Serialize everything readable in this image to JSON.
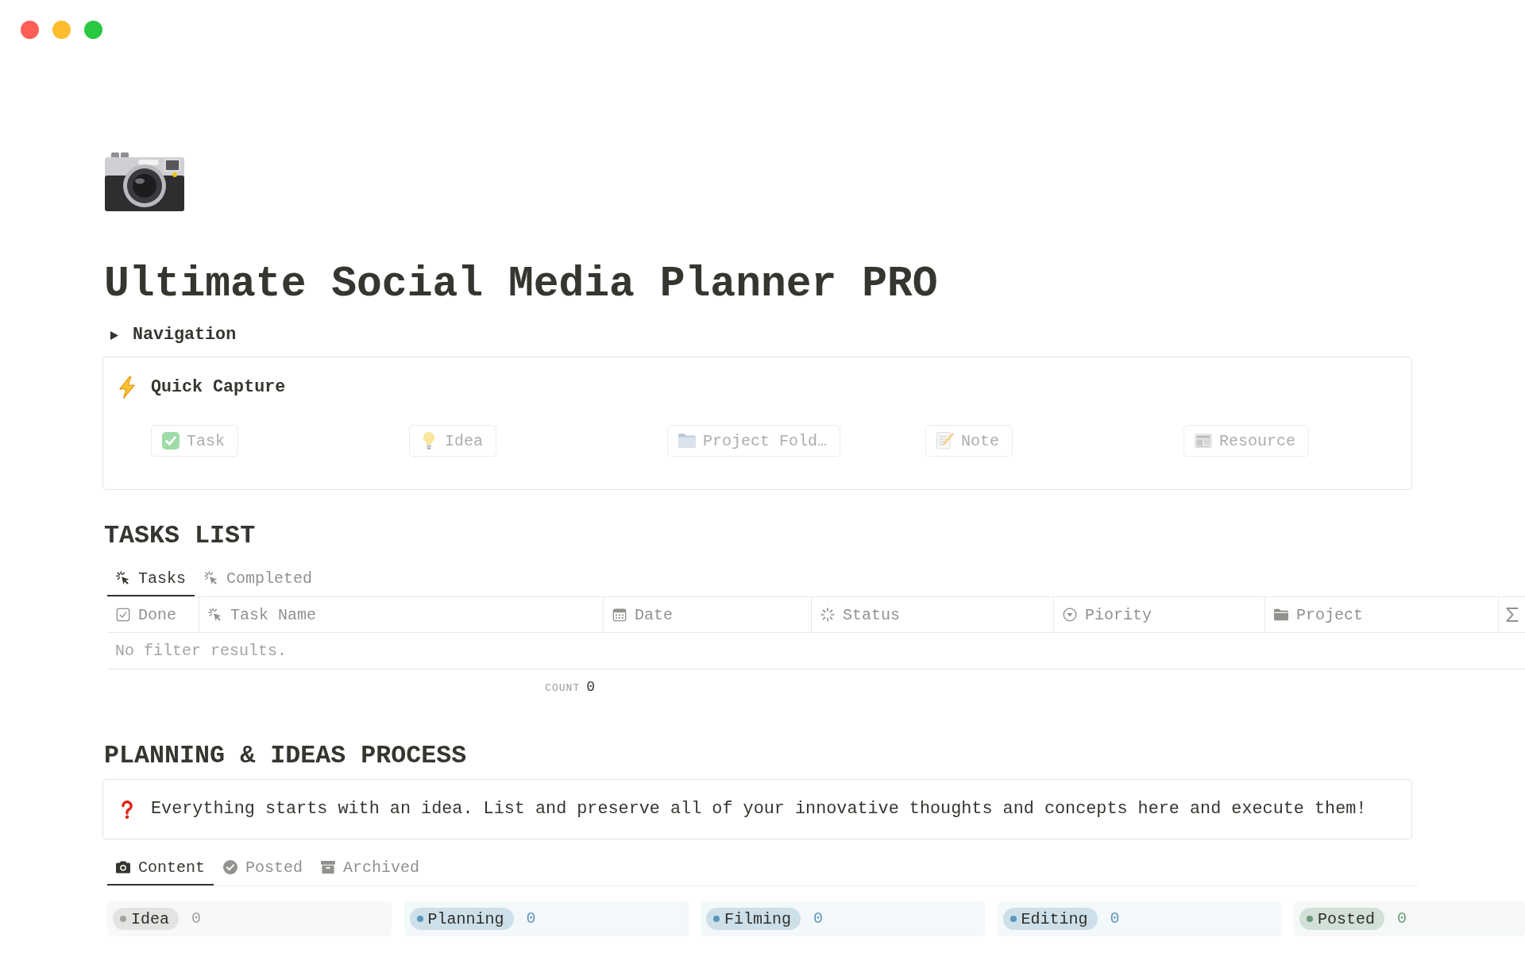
{
  "window_controls": [
    {
      "color": "#ff5f57"
    },
    {
      "color": "#febc2e"
    },
    {
      "color": "#28c840"
    }
  ],
  "page": {
    "title": "Ultimate Social Media Planner PRO"
  },
  "navigation": {
    "label": "Navigation",
    "expanded": false
  },
  "quick_capture": {
    "title": "Quick Capture",
    "buttons": [
      {
        "kind": "task",
        "label": "Task",
        "disabled": true
      },
      {
        "kind": "idea",
        "label": "Idea",
        "disabled": true
      },
      {
        "kind": "project",
        "label": "Project Fold…",
        "disabled": true
      },
      {
        "kind": "note",
        "label": "Note",
        "disabled": true
      },
      {
        "kind": "resource",
        "label": "Resource",
        "disabled": true
      }
    ]
  },
  "tasks_list": {
    "title": "TASKS LIST",
    "tabs": [
      {
        "label": "Tasks",
        "selected": true
      },
      {
        "label": "Completed",
        "selected": false
      }
    ],
    "table": {
      "columns": [
        {
          "kind": "checkbox",
          "label": "Done"
        },
        {
          "kind": "title",
          "label": "Task Name"
        },
        {
          "kind": "date",
          "label": "Date"
        },
        {
          "kind": "status",
          "label": "Status"
        },
        {
          "kind": "select",
          "label": "Piority"
        },
        {
          "kind": "relation",
          "label": "Project"
        },
        {
          "kind": "formula"
        }
      ],
      "empty_message": "No filter results.",
      "calculation": {
        "label": "COUNT",
        "value": "0"
      }
    }
  },
  "planning": {
    "title": "PLANNING & IDEAS PROCESS",
    "callout": "Everything starts with an idea. List and preserve all of your innovative thoughts and concepts here and execute them!",
    "tabs": [
      {
        "label": "Content",
        "selected": true
      },
      {
        "label": "Posted",
        "selected": false
      },
      {
        "label": "Archived",
        "selected": false
      }
    ],
    "groups": [
      {
        "label": "Idea",
        "count": "0",
        "color": "#a3a29e"
      },
      {
        "label": "Planning",
        "count": "0",
        "color": "#5b97bd"
      },
      {
        "label": "Filming",
        "count": "0",
        "color": "#5b97bd"
      },
      {
        "label": "Editing",
        "count": "0",
        "color": "#5b97bd"
      },
      {
        "label": "Posted",
        "count": "0",
        "color": "#6c9b7d"
      }
    ]
  }
}
